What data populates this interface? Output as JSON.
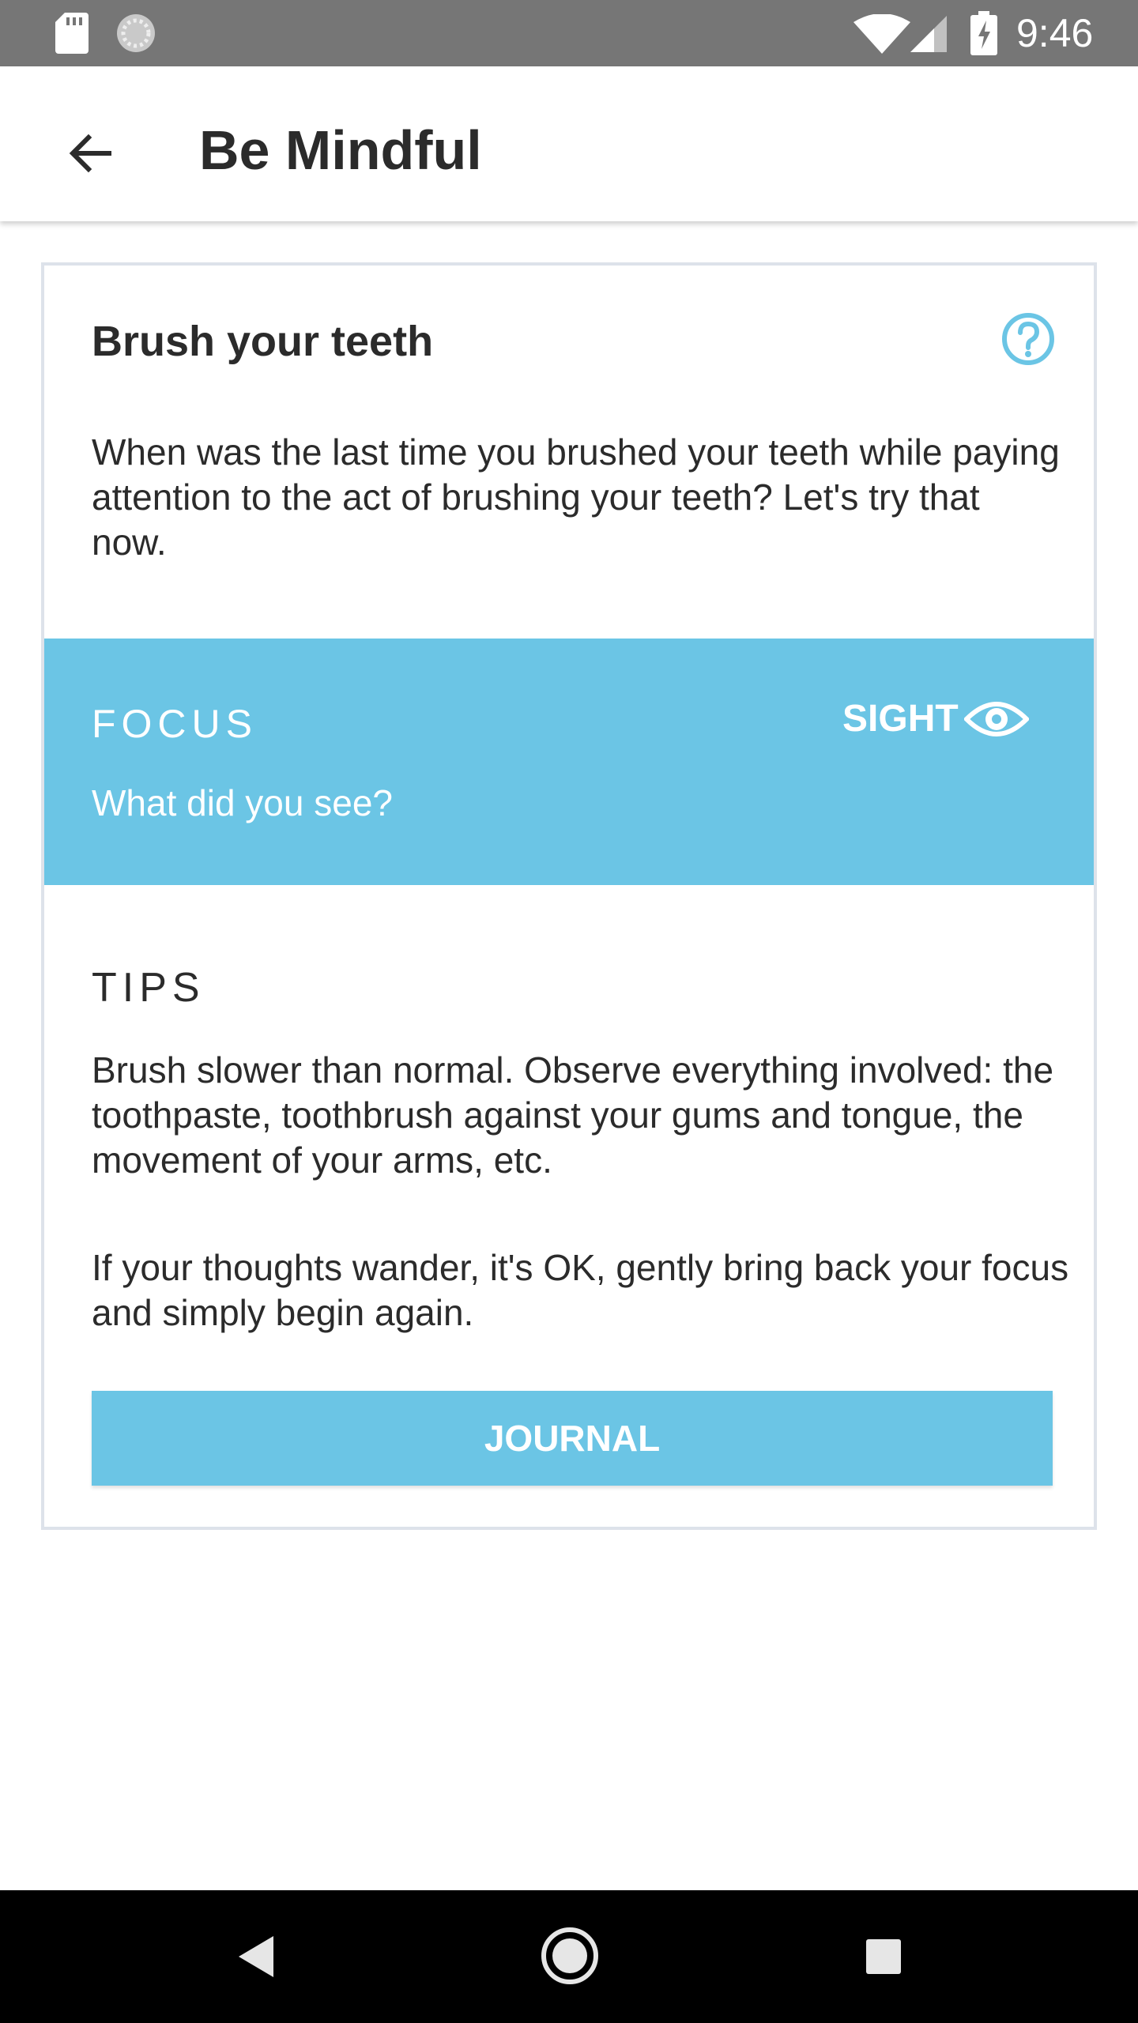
{
  "status_bar": {
    "time": "9:46",
    "icons": [
      "sd-card-icon",
      "sync-icon",
      "wifi-icon",
      "signal-icon",
      "battery-charging-icon"
    ]
  },
  "app_bar": {
    "title": "Be Mindful",
    "back_icon": "arrow-left-icon"
  },
  "card": {
    "title": "Brush your teeth",
    "help_icon": "question-circle-icon",
    "description": "When was the last time you brushed your teeth while paying attention to the act of brushing your teeth? Let's try that now.",
    "focus": {
      "label": "FOCUS",
      "sense": "SIGHT",
      "sense_icon": "eye-icon",
      "question": "What did you see?",
      "background_color": "#6bc5e5"
    },
    "tips": {
      "heading": "TIPS",
      "paragraphs": [
        "Brush slower than normal. Observe everything involved: the toothpaste, toothbrush against your gums and tongue, the movement of your arms, etc.",
        "If your thoughts wander, it's OK, gently bring back your focus and simply begin again."
      ]
    },
    "journal_button": "JOURNAL"
  },
  "nav_bar": {
    "icons": [
      "nav-back-icon",
      "nav-home-icon",
      "nav-recent-icon"
    ]
  },
  "colors": {
    "accent": "#6bc5e5",
    "status_bar": "#767676",
    "card_border": "#dde2ea"
  }
}
